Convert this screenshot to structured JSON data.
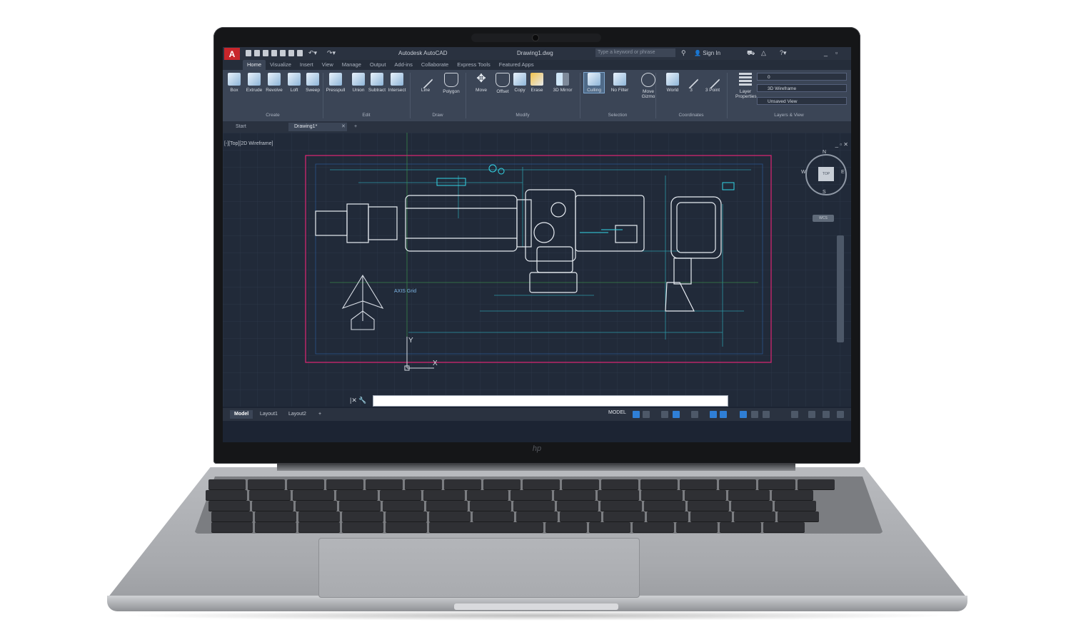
{
  "titlebar": {
    "app_logo": "A",
    "app_title": "Autodesk AutoCAD",
    "doc_title": "Drawing1.dwg",
    "search_placeholder": "Type a keyword or phrase",
    "signin": "Sign In"
  },
  "ribbon_tabs": [
    "Home",
    "Visualize",
    "Insert",
    "View",
    "Manage",
    "Output",
    "Add-ins",
    "Collaborate",
    "Express Tools",
    "Featured Apps"
  ],
  "ribbon": {
    "create": [
      "Box",
      "Extrude",
      "Revolve",
      "Loft",
      "Sweep"
    ],
    "edit": [
      "Presspull",
      "Union",
      "Subtract",
      "Intersect"
    ],
    "draw": [
      "Line",
      "Polygon"
    ],
    "modify": [
      "Move",
      "Offset",
      "Copy",
      "Erase",
      "3D Mirror"
    ],
    "selection": [
      "Culling",
      "No Filter",
      "Move Gizmo"
    ],
    "coordinates": [
      "World",
      "3",
      "3 Point"
    ],
    "layers": "Layer Properties",
    "layer_value": "0",
    "visual_style": "3D Wireframe",
    "view_value": "Unsaved View",
    "panels": {
      "create": "Create",
      "edit": "Edit",
      "draw": "Draw",
      "modify": "Modify",
      "selection": "Selection",
      "coordinates": "Coordinates",
      "layers_view": "Layers & View"
    }
  },
  "file_tabs": {
    "start": "Start",
    "drawing": "Drawing1*"
  },
  "viewport": {
    "label": "[-][Top][2D Wireframe]",
    "annotation": "AXIS Grid",
    "axis_x": "X",
    "axis_y": "Y",
    "viewcube": {
      "top": "TOP",
      "n": "N",
      "s": "S",
      "e": "E",
      "w": "W",
      "wcs": "WCS"
    }
  },
  "command_line": {
    "value": ""
  },
  "status": {
    "layout_tabs": [
      "Model",
      "Layout1",
      "Layout2"
    ],
    "model": "MODEL"
  },
  "colors": {
    "accent": "#2f7fd6",
    "border_magenta": "#d1266e",
    "cyan": "#34d6e6"
  }
}
